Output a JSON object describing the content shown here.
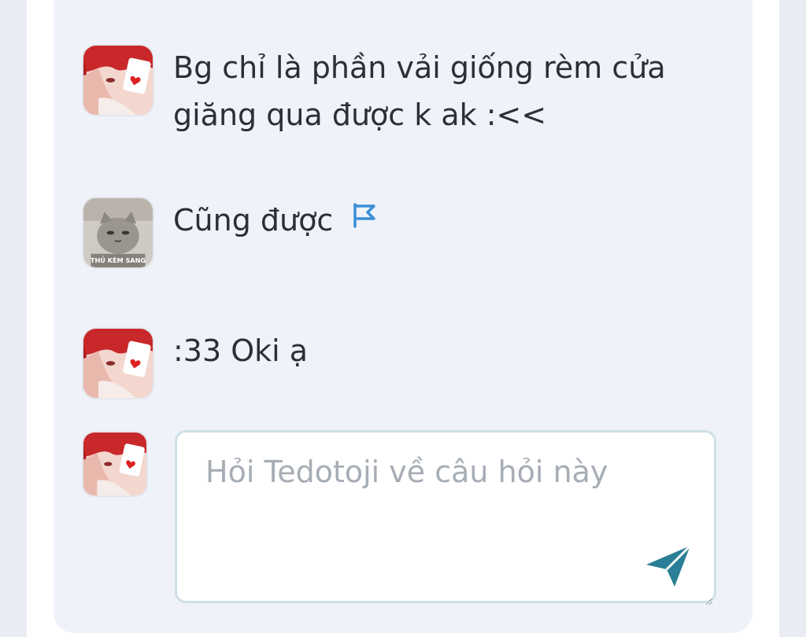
{
  "comments": [
    {
      "author_avatar": "red-hair-avatar-icon",
      "text_line1": "Bg chỉ là phần vải giống rèm cửa",
      "text_line2": "giăng qua được k ak :<<"
    },
    {
      "author_avatar": "cat-avatar-icon",
      "avatar_caption": "THỦ KÈM SANG",
      "text": "Cũng được",
      "flag_icon": "flag-icon"
    },
    {
      "author_avatar": "red-hair-avatar-icon",
      "text": ":33 Oki ạ"
    }
  ],
  "reply": {
    "avatar": "red-hair-avatar-icon",
    "placeholder": "Hỏi Tedotoji về câu hỏi này",
    "value": "",
    "send_icon": "send-icon"
  },
  "colors": {
    "card_bg": "#eff3f9",
    "text": "#2b2f36",
    "placeholder": "#a7adb5",
    "accent_blue": "#3a8fd8",
    "send_teal": "#2a7f96",
    "input_border": "#cfe0e6"
  }
}
